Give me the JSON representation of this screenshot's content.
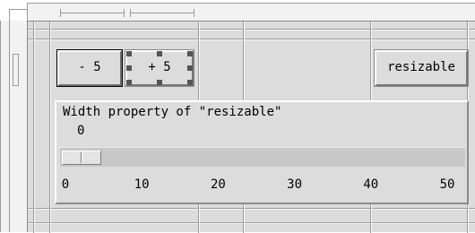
{
  "buttons": {
    "minus_label": "- 5",
    "plus_label": "+ 5",
    "resizable_label": "resizable"
  },
  "slider": {
    "title": "Width property of \"resizable\"",
    "value_text": "0",
    "value": 0,
    "min": 0,
    "max": 50,
    "tick_labels": [
      "0",
      "10",
      "20",
      "30",
      "40",
      "50"
    ]
  },
  "colors": {
    "panel_bg": "#dcdcdc",
    "selection_handle": "#555555"
  },
  "icons": [
    "selection-handle-icon"
  ]
}
